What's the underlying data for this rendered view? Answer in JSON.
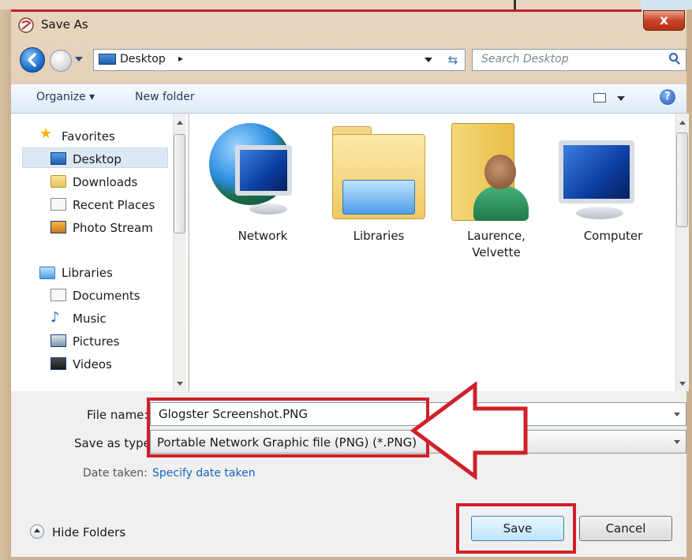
{
  "window": {
    "title": "Save As",
    "close_label": "x"
  },
  "address": {
    "location": "Desktop",
    "chevron": "▸",
    "search_placeholder": "Search Desktop"
  },
  "toolbar": {
    "organize_label": "Organize ▾",
    "new_folder_label": "New folder",
    "help_label": "?"
  },
  "sidebar": {
    "favorites_header": "Favorites",
    "favorites": [
      {
        "label": "Desktop",
        "icon": "desktop-icon",
        "selected": true
      },
      {
        "label": "Downloads",
        "icon": "downloads-icon"
      },
      {
        "label": "Recent Places",
        "icon": "recent-places-icon"
      },
      {
        "label": "Photo Stream",
        "icon": "photo-stream-icon"
      }
    ],
    "libraries_header": "Libraries",
    "libraries": [
      {
        "label": "Documents",
        "icon": "documents-icon"
      },
      {
        "label": "Music",
        "icon": "music-icon"
      },
      {
        "label": "Pictures",
        "icon": "pictures-icon"
      },
      {
        "label": "Videos",
        "icon": "videos-icon"
      }
    ]
  },
  "content": {
    "items": [
      {
        "label": "Network",
        "icon": "network-icon"
      },
      {
        "label": "Libraries",
        "icon": "libraries-icon"
      },
      {
        "label": "Laurence,\nVelvette",
        "label_line1": "Laurence,",
        "label_line2": "Velvette",
        "icon": "user-folder-icon"
      },
      {
        "label": "Computer",
        "icon": "computer-icon"
      }
    ]
  },
  "form": {
    "file_name_label": "File name:",
    "file_name_value": "Glogster Screenshot.PNG",
    "save_type_label": "Save as type:",
    "save_type_value": "Portable Network Graphic file (PNG) (*.PNG)",
    "date_taken_label": "Date taken:",
    "date_taken_link": "Specify date taken"
  },
  "footer": {
    "hide_folders_label": "Hide Folders",
    "save_label": "Save",
    "cancel_label": "Cancel"
  },
  "colors": {
    "annotation": "#d0202a",
    "accent": "#1565c0",
    "selection": "#dde8f5"
  }
}
